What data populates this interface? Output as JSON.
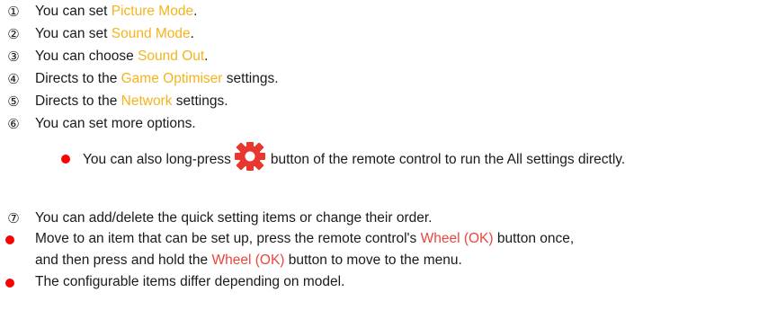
{
  "items": [
    {
      "num": "①",
      "pre": "You can set ",
      "hl": "Picture Mode",
      "post": "."
    },
    {
      "num": "②",
      "pre": "You can set ",
      "hl": "Sound Mode",
      "post": "."
    },
    {
      "num": "③",
      "pre": "You can choose ",
      "hl": "Sound Out",
      "post": "."
    },
    {
      "num": "④",
      "pre": "Directs to the ",
      "hl": "Game Optimiser",
      "post": " settings."
    },
    {
      "num": "⑤",
      "pre": "Directs to the ",
      "hl": "Network",
      "post": " settings."
    },
    {
      "num": "⑥",
      "text": "You can set more options."
    }
  ],
  "sub_bullet": {
    "pre": "You can also long-press",
    "icon": "gear-icon",
    "post": "button of the remote control to run the All settings directly."
  },
  "item7": {
    "num": "⑦",
    "text": "You can add/delete the quick setting items or change their order."
  },
  "note1": {
    "pre": "Move to an item that can be set up, press the remote control's ",
    "hl1": "Wheel (OK)",
    "mid": " button once,",
    "line2_pre": "and then press and hold the ",
    "hl2": "Wheel (OK)",
    "line2_post": " button to move to the menu."
  },
  "note2": {
    "text": "The configurable items differ depending on model."
  },
  "colors": {
    "highlight_yellow": "#f5b31c",
    "highlight_red": "#e8473f",
    "bullet_red": "#ff0000",
    "icon_red": "#e8372f"
  }
}
